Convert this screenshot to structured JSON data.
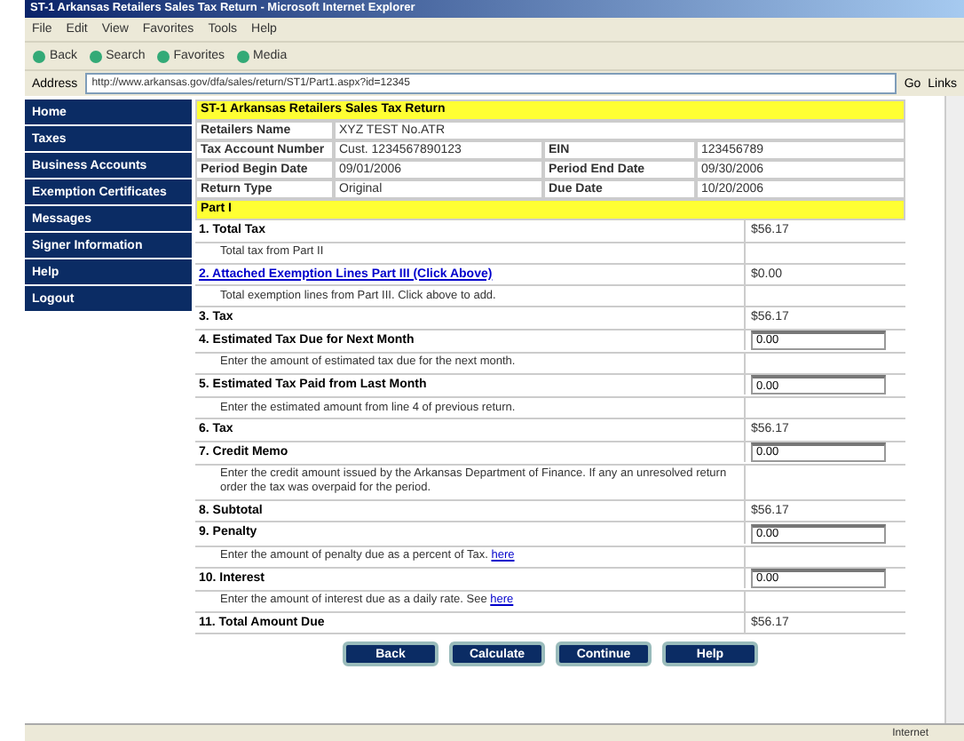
{
  "window": {
    "title": "ST-1 Arkansas Retailers Sales Tax Return - Microsoft Internet Explorer"
  },
  "menu": [
    "File",
    "Edit",
    "View",
    "Favorites",
    "Tools",
    "Help"
  ],
  "toolbar": [
    "Back",
    "Search",
    "Favorites",
    "Media"
  ],
  "address": {
    "label": "Address",
    "value": "http://www.arkansas.gov/dfa/sales/return/ST1/Part1.aspx?id=12345",
    "go": "Go",
    "links": "Links"
  },
  "sidebar": {
    "items": [
      "Home",
      "Taxes",
      "Business Accounts",
      "Exemption Certificates",
      "Messages",
      "Signer Information",
      "Help",
      "Logout"
    ]
  },
  "form": {
    "title": "ST-1 Arkansas Retailers Sales Tax Return",
    "info": [
      [
        "Retailers Name",
        "XYZ TEST No.ATR"
      ],
      [
        "Tax Account Number",
        "Cust. 1234567890123",
        "EIN",
        "123456789"
      ],
      [
        "Period Begin Date",
        "09/01/2006",
        "Period End Date",
        "09/30/2006"
      ],
      [
        "Return Type",
        "Original",
        "Due Date",
        "10/20/2006"
      ]
    ],
    "part": "Part I",
    "rows": [
      {
        "kind": "total",
        "label": "1. Total Tax",
        "value": "$56.17"
      },
      {
        "kind": "note",
        "text": "Total tax from Part II"
      },
      {
        "kind": "link",
        "label": "2. Attached Exemption Lines Part III (Click Above)",
        "value": "$0.00"
      },
      {
        "kind": "note",
        "text": "Total exemption lines from Part III. Click above to add."
      },
      {
        "kind": "total",
        "label": "3. Tax",
        "value": "$56.17"
      },
      {
        "kind": "input",
        "label": "4. Estimated Tax Due for Next Month",
        "value": "0.00"
      },
      {
        "kind": "note",
        "text": "Enter the amount of estimated tax due for the next month."
      },
      {
        "kind": "input",
        "label": "5. Estimated Tax Paid from Last Month",
        "value": "0.00"
      },
      {
        "kind": "note",
        "text": "Enter the estimated amount from line 4 of previous return."
      },
      {
        "kind": "total",
        "label": "6. Tax",
        "value": "$56.17"
      },
      {
        "kind": "input",
        "label": "7. Credit Memo",
        "value": "0.00"
      },
      {
        "kind": "note",
        "text": "Enter the credit amount issued by the Arkansas Department of Finance. If any an unresolved return order the tax was overpaid for the period."
      },
      {
        "kind": "total",
        "label": "8. Subtotal",
        "value": "$56.17"
      },
      {
        "kind": "input",
        "label": "9. Penalty",
        "value": "0.00"
      },
      {
        "kind": "note",
        "text": "Enter the amount of penalty due as a percent of Tax.",
        "link": "here"
      },
      {
        "kind": "input",
        "label": "10. Interest",
        "value": "0.00"
      },
      {
        "kind": "note",
        "text": "Enter the amount of interest due as a daily rate. See",
        "link": "here"
      },
      {
        "kind": "total",
        "label": "11. Total Amount Due",
        "value": "$56.17"
      }
    ],
    "buttons": [
      "Back",
      "Calculate",
      "Continue",
      "Help"
    ]
  },
  "status_bar": {
    "zone": "Internet"
  }
}
